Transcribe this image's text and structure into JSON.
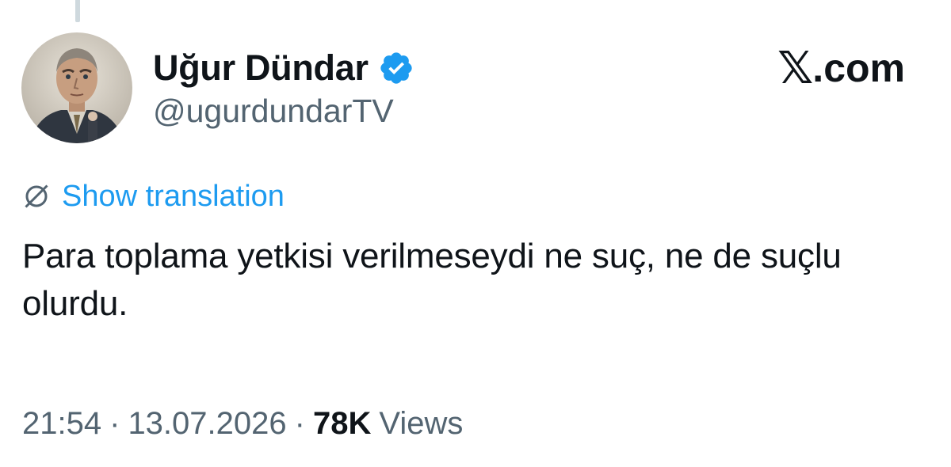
{
  "author": {
    "display_name": "Uğur Dündar",
    "handle": "@ugurdundarTV",
    "verified": true,
    "avatar_icon": "portrait-avatar"
  },
  "brand": {
    "label": ".com",
    "logo_icon": "x-logo-icon"
  },
  "translation": {
    "icon": "globe-icon",
    "label": "Show translation",
    "color": "#1d9bf0"
  },
  "tweet": {
    "text": "Para toplama yetkisi verilmeseydi ne suç, ne de suçlu olurdu."
  },
  "meta": {
    "time": "21:54",
    "separator": "·",
    "date": "13.07.2026",
    "views_count": "78K",
    "views_label": "Views"
  },
  "colors": {
    "text_primary": "#0f1419",
    "text_secondary": "#536471",
    "verified_blue": "#1d9bf0"
  }
}
